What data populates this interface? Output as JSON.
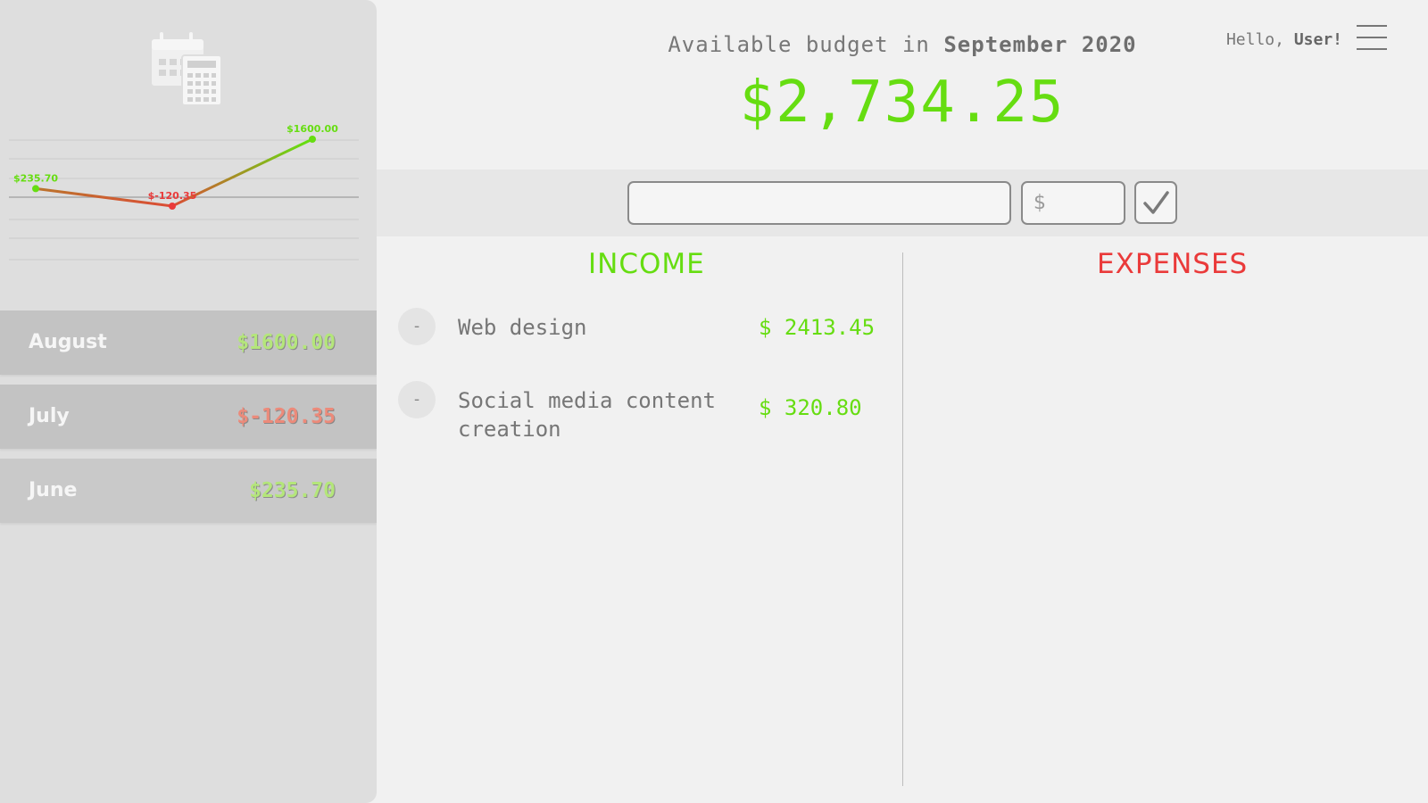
{
  "colors": {
    "positive": "#66dd11",
    "negative": "#ea3a3a",
    "text_muted": "#777777",
    "sidebar_bg": "#dedede",
    "month_row_bg": "#c3c3c3"
  },
  "icons": {
    "sidebar_logo": "calendar-calculator-icon",
    "menu": "hamburger-menu-icon",
    "submit": "checkmark-icon",
    "delete": "minus-icon"
  },
  "chart_data": {
    "type": "line",
    "categories": [
      "June",
      "July",
      "August"
    ],
    "values": [
      235.7,
      -120.35,
      1600.0
    ],
    "data_labels": [
      "$235.70",
      "$-120.35",
      "$1600.00"
    ],
    "ylim": [
      -350,
      1700
    ],
    "grid": true
  },
  "months": [
    {
      "name": "August",
      "value": "$1600.00",
      "positive": true
    },
    {
      "name": "July",
      "value": "$-120.35",
      "positive": false
    },
    {
      "name": "June",
      "value": "$235.70",
      "positive": true
    }
  ],
  "header": {
    "title_prefix": "Available budget in",
    "title_month": "September 2020",
    "budget_amount": "$2,734.25",
    "greeting_prefix": "Hello,",
    "greeting_user": "User!"
  },
  "input_bar": {
    "description_value": "",
    "description_placeholder": "",
    "value_placeholder": "$"
  },
  "income": {
    "title": "INCOME",
    "items": [
      {
        "description": "Web design",
        "value": "$ 2413.45",
        "delete_label": "-"
      },
      {
        "description": "Social media content creation",
        "value": "$ 320.80",
        "delete_label": "-"
      }
    ]
  },
  "expenses": {
    "title": "EXPENSES",
    "items": []
  }
}
